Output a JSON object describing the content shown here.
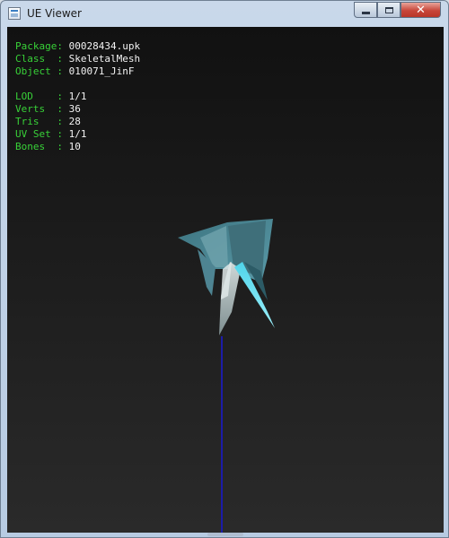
{
  "window": {
    "title": "UE Viewer",
    "icon": "app-icon",
    "controls": {
      "minimize": "minimize-icon",
      "maximize": "maximize-icon",
      "close": "close-icon",
      "close_glyph": "✕"
    }
  },
  "info": {
    "package": {
      "label": "Package",
      "sep": ": ",
      "value": "00028434.upk"
    },
    "class": {
      "label": "Class  ",
      "sep": ": ",
      "value": "SkeletalMesh"
    },
    "object": {
      "label": "Object ",
      "sep": ": ",
      "value": "010071_JinF"
    },
    "lod": {
      "label": "LOD    ",
      "sep": ": ",
      "value": "1/1"
    },
    "verts": {
      "label": "Verts  ",
      "sep": ": ",
      "value": "36"
    },
    "tris": {
      "label": "Tris   ",
      "sep": ": ",
      "value": "28"
    },
    "uvset": {
      "label": "UV Set ",
      "sep": ": ",
      "value": "1/1"
    },
    "bones": {
      "label": "Bones  ",
      "sep": ": ",
      "value": "10"
    }
  },
  "colors": {
    "label": "#38d138",
    "value": "#f2f2f2",
    "viewport_top": "#111111",
    "viewport_bottom": "#2a2a2a",
    "bone_line": "#1c1ca8",
    "mesh_teal": "#4f8f9c",
    "mesh_light": "#6fe0f0"
  }
}
